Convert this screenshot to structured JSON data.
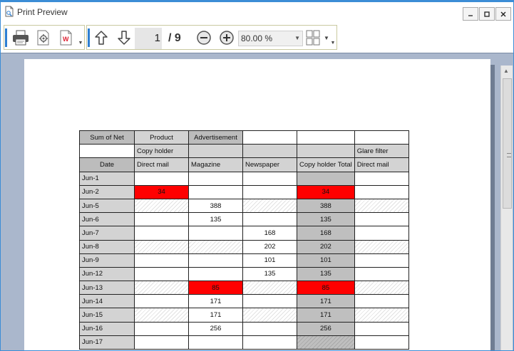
{
  "window": {
    "title": "Print Preview"
  },
  "toolbar": {
    "current_page": "1",
    "page_total": "/ 9",
    "zoom_value": "80.00 %"
  },
  "table": {
    "header_row1": [
      "Sum of Net",
      "Product",
      "Advertisement",
      "",
      "",
      ""
    ],
    "header_row2": [
      "",
      "Copy holder",
      "",
      "",
      "",
      "Glare filter"
    ],
    "header_row3": [
      "Date",
      "Direct mail",
      "Magazine",
      "Newspaper",
      "Copy holder Total",
      "Direct mail"
    ],
    "rows": [
      {
        "date": "Jun-1",
        "cells": [
          "",
          "",
          "",
          "",
          ""
        ],
        "hatch": [
          false,
          false,
          false,
          false,
          false
        ],
        "red": [
          false,
          false,
          false,
          false,
          false
        ]
      },
      {
        "date": "Jun-2",
        "cells": [
          "34",
          "",
          "",
          "34",
          ""
        ],
        "hatch": [
          false,
          false,
          false,
          false,
          false
        ],
        "red": [
          true,
          false,
          false,
          true,
          false
        ]
      },
      {
        "date": "Jun-5",
        "cells": [
          "",
          "388",
          "",
          "388",
          ""
        ],
        "hatch": [
          true,
          false,
          true,
          false,
          true
        ],
        "red": [
          false,
          false,
          false,
          false,
          false
        ]
      },
      {
        "date": "Jun-6",
        "cells": [
          "",
          "135",
          "",
          "135",
          ""
        ],
        "hatch": [
          false,
          false,
          false,
          false,
          false
        ],
        "red": [
          false,
          false,
          false,
          false,
          false
        ]
      },
      {
        "date": "Jun-7",
        "cells": [
          "",
          "",
          "168",
          "168",
          ""
        ],
        "hatch": [
          false,
          false,
          false,
          false,
          false
        ],
        "red": [
          false,
          false,
          false,
          false,
          false
        ]
      },
      {
        "date": "Jun-8",
        "cells": [
          "",
          "",
          "202",
          "202",
          ""
        ],
        "hatch": [
          true,
          true,
          false,
          false,
          true
        ],
        "red": [
          false,
          false,
          false,
          false,
          false
        ]
      },
      {
        "date": "Jun-9",
        "cells": [
          "",
          "",
          "101",
          "101",
          ""
        ],
        "hatch": [
          false,
          false,
          false,
          false,
          false
        ],
        "red": [
          false,
          false,
          false,
          false,
          false
        ]
      },
      {
        "date": "Jun-12",
        "cells": [
          "",
          "",
          "135",
          "135",
          ""
        ],
        "hatch": [
          false,
          false,
          false,
          false,
          false
        ],
        "red": [
          false,
          false,
          false,
          false,
          false
        ]
      },
      {
        "date": "Jun-13",
        "cells": [
          "",
          "85",
          "",
          "85",
          ""
        ],
        "hatch": [
          true,
          false,
          true,
          false,
          true
        ],
        "red": [
          false,
          true,
          false,
          true,
          false
        ]
      },
      {
        "date": "Jun-14",
        "cells": [
          "",
          "171",
          "",
          "171",
          ""
        ],
        "hatch": [
          false,
          false,
          false,
          false,
          false
        ],
        "red": [
          false,
          false,
          false,
          false,
          false
        ]
      },
      {
        "date": "Jun-15",
        "cells": [
          "",
          "171",
          "",
          "171",
          ""
        ],
        "hatch": [
          true,
          false,
          true,
          false,
          true
        ],
        "red": [
          false,
          false,
          false,
          false,
          false
        ]
      },
      {
        "date": "Jun-16",
        "cells": [
          "",
          "256",
          "",
          "256",
          ""
        ],
        "hatch": [
          false,
          false,
          false,
          false,
          false
        ],
        "red": [
          false,
          false,
          false,
          false,
          false
        ]
      },
      {
        "date": "Jun-17",
        "cells": [
          "",
          "",
          "",
          "",
          ""
        ],
        "hatch": [
          false,
          false,
          false,
          true,
          false
        ],
        "red": [
          false,
          false,
          false,
          false,
          false
        ]
      }
    ]
  },
  "colors": {
    "accent": "#3c8dd6",
    "highlight": "#ff0000",
    "total_column": "#bfbfbf",
    "header_gray": "#bcbcbc",
    "preview_background": "#aab7cc"
  }
}
